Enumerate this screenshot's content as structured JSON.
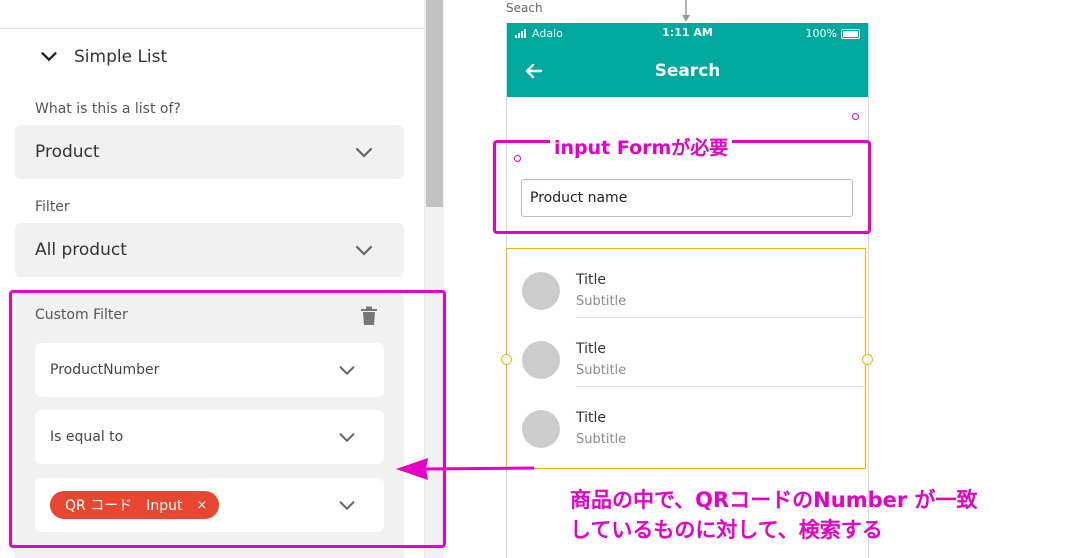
{
  "left_panel": {
    "section_title": "Simple List",
    "list_of_label": "What is this a list of?",
    "list_of_value": "Product",
    "filter_label": "Filter",
    "filter_value": "All product",
    "custom_filter": {
      "title": "Custom Filter",
      "field_value": "ProductNumber",
      "operator_value": "Is equal to",
      "chip_label": "QR コード　Input",
      "chip_close": "×"
    }
  },
  "canvas": {
    "screen_name": "Seach",
    "status": {
      "carrier": "Adalo",
      "time": "1:11 AM",
      "battery": "100%"
    },
    "nav_title": "Search",
    "input_value": "Product name",
    "list_items": [
      {
        "title": "Title",
        "subtitle": "Subtitle"
      },
      {
        "title": "Title",
        "subtitle": "Subtitle"
      },
      {
        "title": "Title",
        "subtitle": "Subtitle"
      }
    ],
    "header_color": "#00a99d"
  },
  "annotations": {
    "input_note": "input Formが必要",
    "search_note_line1": "商品の中で、QRコードのNumber が一致",
    "search_note_line2": "しているものに対して、検索する",
    "color": "#e600c7"
  }
}
